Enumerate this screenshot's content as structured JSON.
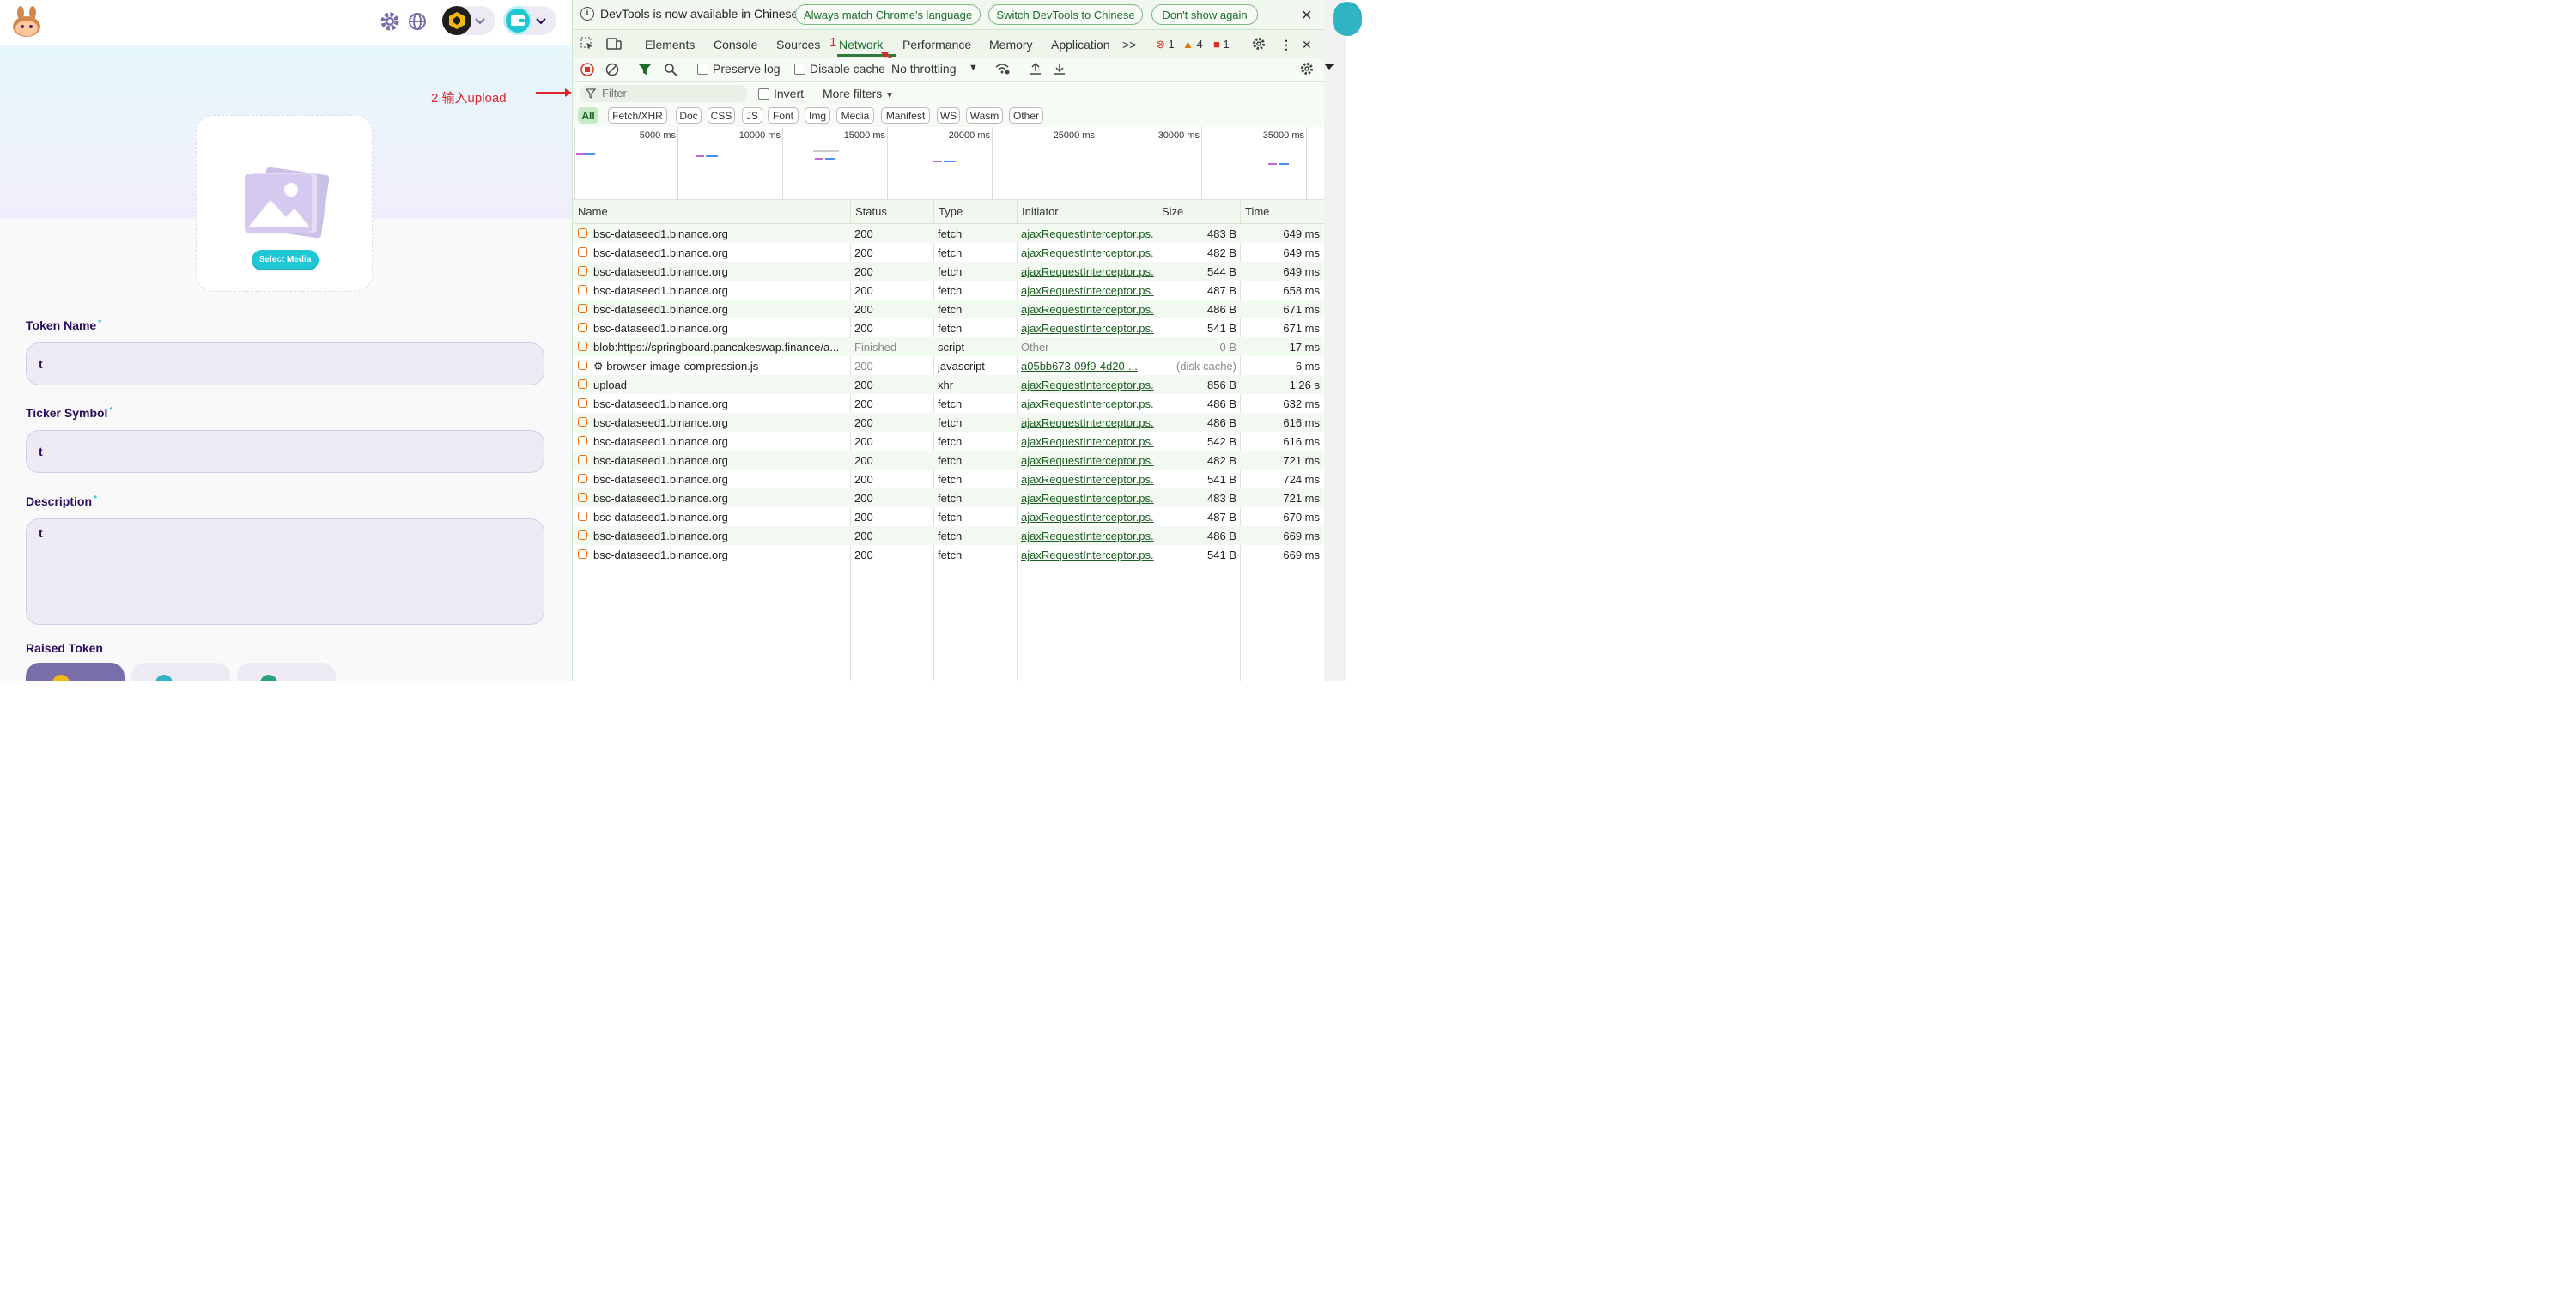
{
  "app": {
    "select_media_label": "Select Media",
    "fields": {
      "token_name": {
        "label": "Token Name",
        "value": "t"
      },
      "ticker_symbol": {
        "label": "Ticker Symbol",
        "value": "t"
      },
      "description": {
        "label": "Description",
        "value": "t"
      }
    },
    "raised_token_label": "Raised Token",
    "required_mark": "*"
  },
  "annotations": {
    "step1": "1",
    "step2": "2.输入upload"
  },
  "devtools": {
    "infobar": {
      "message": "DevTools is now available in Chinese!",
      "btn_match": "Always match Chrome's language",
      "btn_switch": "Switch DevTools to Chinese",
      "btn_dismiss": "Don't show again"
    },
    "tabs": [
      "Elements",
      "Console",
      "Sources",
      "Network",
      "Performance",
      "Memory",
      "Application"
    ],
    "more_tabs": ">>",
    "errors": "1",
    "warnings": "4",
    "issues": "1",
    "toolbar": {
      "preserve_log": "Preserve log",
      "disable_cache": "Disable cache",
      "throttling": "No throttling"
    },
    "filter": {
      "placeholder": "Filter",
      "invert": "Invert",
      "more_filters": "More filters"
    },
    "type_filters": [
      "All",
      "Fetch/XHR",
      "Doc",
      "CSS",
      "JS",
      "Font",
      "Img",
      "Media",
      "Manifest",
      "WS",
      "Wasm",
      "Other"
    ],
    "overview_ticks": [
      "5000 ms",
      "10000 ms",
      "15000 ms",
      "20000 ms",
      "25000 ms",
      "30000 ms",
      "35000 ms"
    ],
    "columns": [
      "Name",
      "Status",
      "Type",
      "Initiator",
      "Size",
      "Time"
    ],
    "rows": [
      {
        "name": "bsc-dataseed1.binance.org",
        "status": "200",
        "type": "fetch",
        "initiator": "ajaxRequestInterceptor.ps.",
        "size": "483 B",
        "time": "649 ms"
      },
      {
        "name": "bsc-dataseed1.binance.org",
        "status": "200",
        "type": "fetch",
        "initiator": "ajaxRequestInterceptor.ps.",
        "size": "482 B",
        "time": "649 ms"
      },
      {
        "name": "bsc-dataseed1.binance.org",
        "status": "200",
        "type": "fetch",
        "initiator": "ajaxRequestInterceptor.ps.",
        "size": "544 B",
        "time": "649 ms"
      },
      {
        "name": "bsc-dataseed1.binance.org",
        "status": "200",
        "type": "fetch",
        "initiator": "ajaxRequestInterceptor.ps.",
        "size": "487 B",
        "time": "658 ms"
      },
      {
        "name": "bsc-dataseed1.binance.org",
        "status": "200",
        "type": "fetch",
        "initiator": "ajaxRequestInterceptor.ps.",
        "size": "486 B",
        "time": "671 ms"
      },
      {
        "name": "bsc-dataseed1.binance.org",
        "status": "200",
        "type": "fetch",
        "initiator": "ajaxRequestInterceptor.ps.",
        "size": "541 B",
        "time": "671 ms"
      },
      {
        "name": "blob:https://springboard.pancakeswap.finance/a...",
        "status": "Finished",
        "type": "script",
        "initiator": "Other",
        "size": "0 B",
        "time": "17 ms",
        "dim": true
      },
      {
        "name": "⚙ browser-image-compression.js",
        "status": "200",
        "type": "javascript",
        "initiator": "a05bb673-09f9-4d20-...",
        "size": "(disk cache)",
        "time": "6 ms",
        "dim": true,
        "link": true
      },
      {
        "name": "upload",
        "status": "200",
        "type": "xhr",
        "initiator": "ajaxRequestInterceptor.ps.",
        "size": "856 B",
        "time": "1.26 s"
      },
      {
        "name": "bsc-dataseed1.binance.org",
        "status": "200",
        "type": "fetch",
        "initiator": "ajaxRequestInterceptor.ps.",
        "size": "486 B",
        "time": "632 ms"
      },
      {
        "name": "bsc-dataseed1.binance.org",
        "status": "200",
        "type": "fetch",
        "initiator": "ajaxRequestInterceptor.ps.",
        "size": "486 B",
        "time": "616 ms"
      },
      {
        "name": "bsc-dataseed1.binance.org",
        "status": "200",
        "type": "fetch",
        "initiator": "ajaxRequestInterceptor.ps.",
        "size": "542 B",
        "time": "616 ms"
      },
      {
        "name": "bsc-dataseed1.binance.org",
        "status": "200",
        "type": "fetch",
        "initiator": "ajaxRequestInterceptor.ps.",
        "size": "482 B",
        "time": "721 ms"
      },
      {
        "name": "bsc-dataseed1.binance.org",
        "status": "200",
        "type": "fetch",
        "initiator": "ajaxRequestInterceptor.ps.",
        "size": "541 B",
        "time": "724 ms"
      },
      {
        "name": "bsc-dataseed1.binance.org",
        "status": "200",
        "type": "fetch",
        "initiator": "ajaxRequestInterceptor.ps.",
        "size": "483 B",
        "time": "721 ms"
      },
      {
        "name": "bsc-dataseed1.binance.org",
        "status": "200",
        "type": "fetch",
        "initiator": "ajaxRequestInterceptor.ps.",
        "size": "487 B",
        "time": "670 ms"
      },
      {
        "name": "bsc-dataseed1.binance.org",
        "status": "200",
        "type": "fetch",
        "initiator": "ajaxRequestInterceptor.ps.",
        "size": "486 B",
        "time": "669 ms"
      },
      {
        "name": "bsc-dataseed1.binance.org",
        "status": "200",
        "type": "fetch",
        "initiator": "ajaxRequestInterceptor.ps.",
        "size": "541 B",
        "time": "669 ms"
      }
    ]
  },
  "colors": {
    "brand_teal": "#1fc7d4",
    "brand_purple": "#7645d9",
    "annotation_red": "#e0262b",
    "devtools_accent": "#1b6d2c"
  }
}
